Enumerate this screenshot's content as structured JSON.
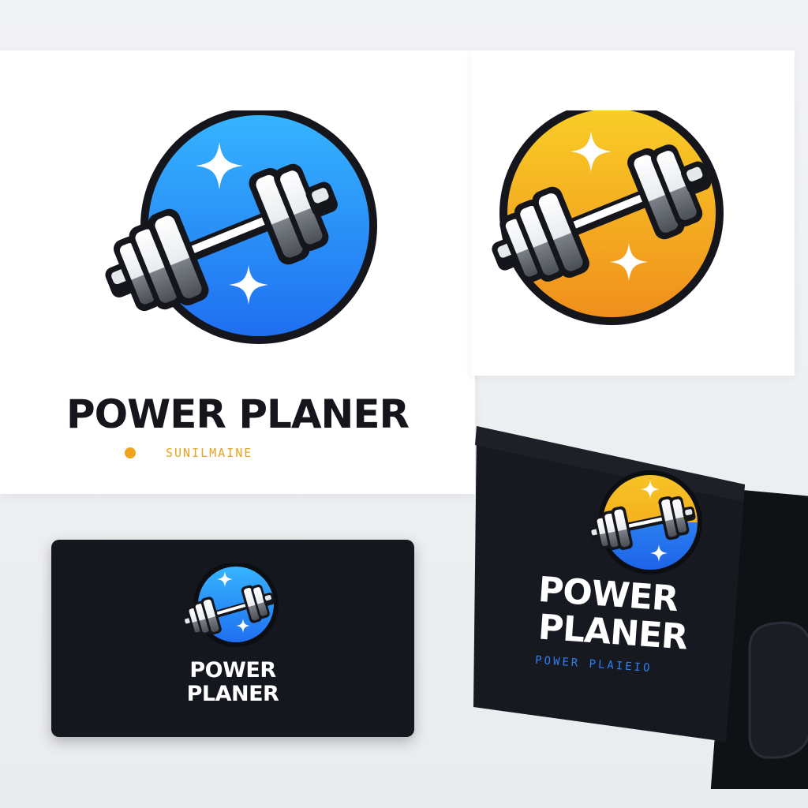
{
  "main_logo": {
    "brand_name": "POWER PLANER",
    "tagline": "SUNILMAINE",
    "icon": "dumbbell-icon",
    "colors": {
      "blue": "#2b8cf5",
      "yellow": "#f3b21e",
      "ink": "#14161c",
      "tagline": "#e7a321"
    }
  },
  "alt_logo": {
    "icon": "dumbbell-icon"
  },
  "business_card": {
    "line1": "POWER",
    "line2": "PLANER",
    "icon": "dumbbell-icon"
  },
  "folder": {
    "line1": "POWER",
    "line2": "PLANER",
    "subline": "POWER PLAIEIO",
    "icon": "dumbbell-icon"
  }
}
